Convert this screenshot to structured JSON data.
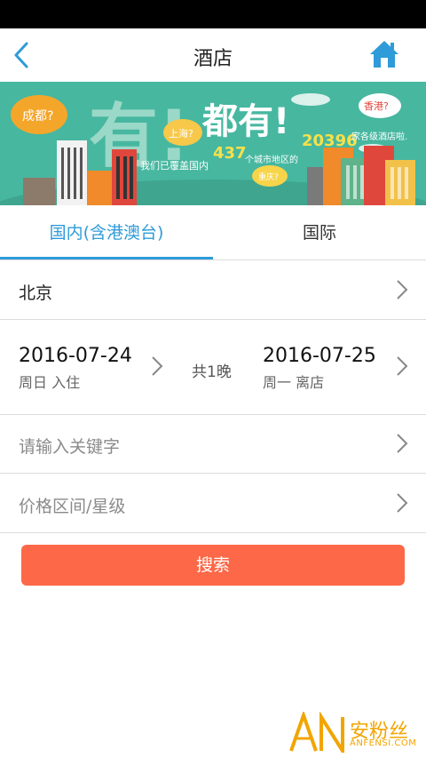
{
  "nav": {
    "title": "酒店"
  },
  "banner": {
    "big_text_1": "有!",
    "big_text_2": "都有!",
    "line": "我们已覆盖国内",
    "num_cities": "437",
    "line_mid": "个城市地区的",
    "num_hotels": "20396",
    "line_end": "家各级酒店啦.",
    "bubbles": [
      "成都?",
      "上海?",
      "香港?",
      "重庆?"
    ]
  },
  "tabs": {
    "domestic": "国内(含港澳台)",
    "international": "国际"
  },
  "city": {
    "value": "北京"
  },
  "dates": {
    "checkin_date": "2016-07-24",
    "checkin_sub": "周日 入住",
    "nights": "共1晚",
    "checkout_date": "2016-07-25",
    "checkout_sub": "周一 离店"
  },
  "keyword": {
    "placeholder": "请输入关键字"
  },
  "price": {
    "placeholder": "价格区间/星级"
  },
  "search": {
    "label": "搜索"
  },
  "watermark": {
    "brand": "安粉丝",
    "domain": "ANFENSI.COM",
    "logo_text": "AN"
  },
  "colors": {
    "accent_blue": "#2f9bd8",
    "button_orange": "#fc6848",
    "banner_teal": "#47b7a0"
  }
}
